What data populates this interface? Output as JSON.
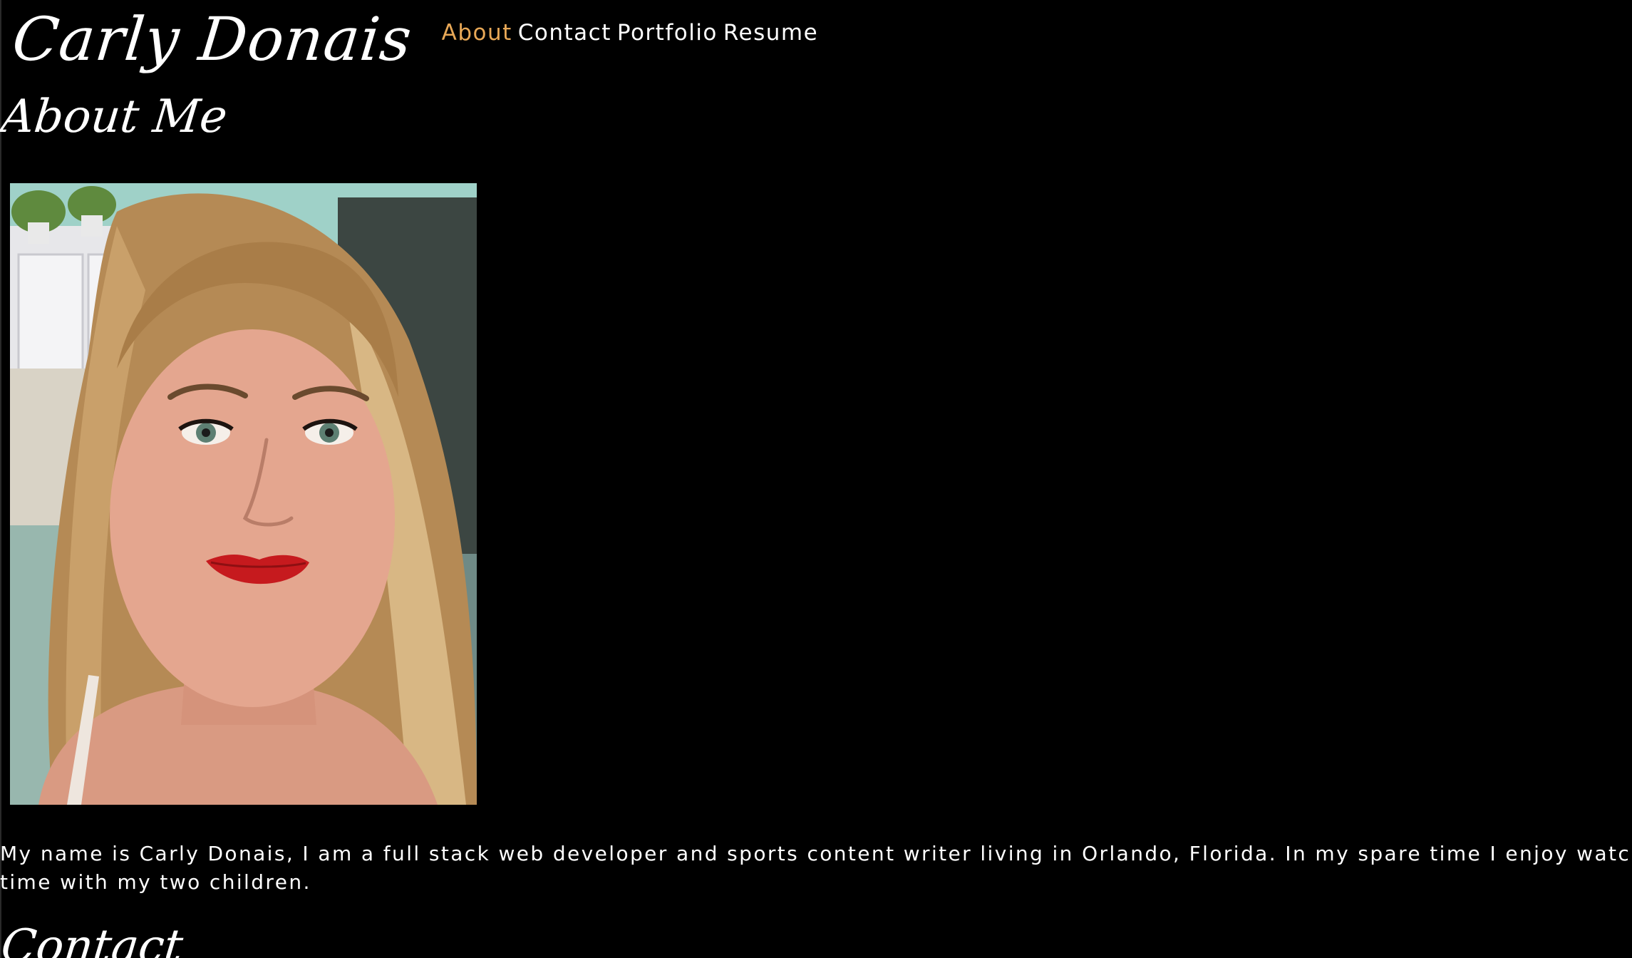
{
  "header": {
    "site_name": "Carly Donais",
    "nav": [
      {
        "label": "About",
        "active": true
      },
      {
        "label": "Contact",
        "active": false
      },
      {
        "label": "Portfolio",
        "active": false
      },
      {
        "label": "Resume",
        "active": false
      }
    ]
  },
  "about": {
    "heading": "About Me",
    "photo_alt": "Portrait photo of Carly Donais",
    "bio_line1": "My name is Carly Donais, I am a full stack web developer and sports content writer living in Orlando, Florida. In my spare time I enjoy watching sp",
    "bio_line2": "time with my two children."
  },
  "contact": {
    "heading": "Contact"
  },
  "colors": {
    "background": "#000000",
    "text": "#ffffff",
    "accent": "#e8a857"
  }
}
